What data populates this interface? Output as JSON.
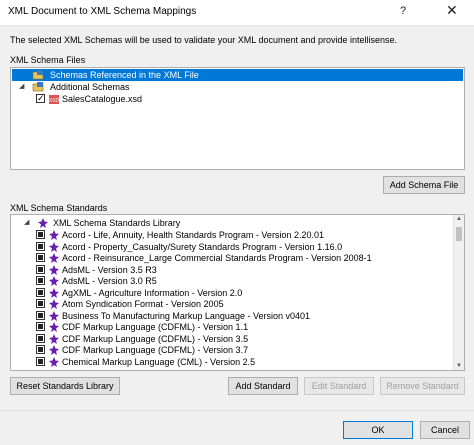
{
  "window": {
    "title": "XML Document to XML Schema Mappings",
    "help": "?",
    "close": "✕"
  },
  "description": "The selected XML Schemas will be used to validate your XML document and provide intellisense.",
  "schema_files": {
    "label": "XML Schema Files",
    "items": [
      {
        "label": "Schemas Referenced in the XML File",
        "selected": true,
        "icon": "schema-folder-icon"
      },
      {
        "label": "Additional Schemas",
        "selected": false,
        "icon": "schema-folder-icon"
      },
      {
        "label": "SalesCatalogue.xsd",
        "selected": false,
        "icon": "xsd-file-icon",
        "checked": true
      }
    ],
    "add_button": "Add Schema File"
  },
  "standards": {
    "label": "XML Schema Standards",
    "root": "XML Schema Standards Library",
    "items": [
      "Acord - Life, Annuity, Health Standards Program - Version 2.20.01",
      "Acord - Property_Casualty/Surety Standards Program - Version 1.16.0",
      "Acord - Reinsurance_Large Commercial Standards Program - Version 2008-1",
      "AdsML - Version 3.5 R3",
      "AdsML - Version 3.0 R5",
      "AgXML - Agriculture Information - Version 2.0",
      "Atom Syndication Format - Version 2005",
      "Business To Manufacturing Markup Language - Version v0401",
      "CDF Markup Language (CDFML) - Version 1.1",
      "CDF Markup Language (CDFML) - Version 3.5",
      "CDF Markup Language (CDFML) - Version 3.7",
      "Chemical Markup Language (CML) - Version 2.5"
    ]
  },
  "buttons": {
    "reset": "Reset Standards Library",
    "add": "Add Standard",
    "edit": "Edit Standard",
    "remove": "Remove Standard",
    "ok": "OK",
    "cancel": "Cancel"
  },
  "colors": {
    "selection": "#0078d7",
    "standard_icon": "#6a1fb0"
  }
}
